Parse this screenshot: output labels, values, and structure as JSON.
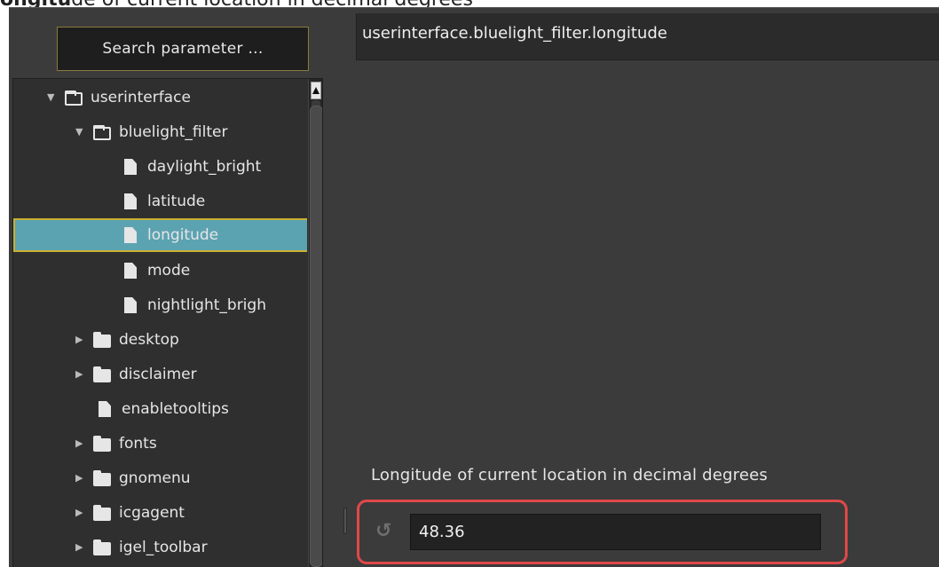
{
  "header": {
    "cut_title_bold": "ongitu",
    "cut_title_rest": "de of current location in decimal degrees"
  },
  "sidebar": {
    "search_label": "Search parameter ...",
    "tree": [
      {
        "label": "userinterface",
        "type": "folder-open",
        "expanded": true,
        "level": 0
      },
      {
        "label": "bluelight_filter",
        "type": "folder-open",
        "expanded": true,
        "level": 1
      },
      {
        "label": "daylight_bright",
        "type": "file",
        "level": 2
      },
      {
        "label": "latitude",
        "type": "file",
        "level": 2
      },
      {
        "label": "longitude",
        "type": "file",
        "level": 2,
        "selected": true
      },
      {
        "label": "mode",
        "type": "file",
        "level": 2
      },
      {
        "label": "nightlight_brigh",
        "type": "file",
        "level": 2
      },
      {
        "label": "desktop",
        "type": "folder-closed",
        "expanded": false,
        "level": 1
      },
      {
        "label": "disclaimer",
        "type": "folder-closed",
        "expanded": false,
        "level": 1
      },
      {
        "label": "enabletooltips",
        "type": "file",
        "level": 1
      },
      {
        "label": "fonts",
        "type": "folder-closed",
        "expanded": false,
        "level": 1
      },
      {
        "label": "gnomenu",
        "type": "folder-closed",
        "expanded": false,
        "level": 1
      },
      {
        "label": "icgagent",
        "type": "folder-closed",
        "expanded": false,
        "level": 1
      },
      {
        "label": "igel_toolbar",
        "type": "folder-closed",
        "expanded": false,
        "level": 1
      }
    ]
  },
  "main": {
    "parameter_path": "userinterface.bluelight_filter.longitude",
    "description": "Longitude of current location in decimal degrees",
    "value": "48.36",
    "reset_icon": "reset-icon"
  },
  "colors": {
    "panel_bg": "#3b3b3b",
    "selection_bg": "#5ca3b2",
    "selection_border": "#c9b033",
    "highlight_ring": "#e04848"
  }
}
